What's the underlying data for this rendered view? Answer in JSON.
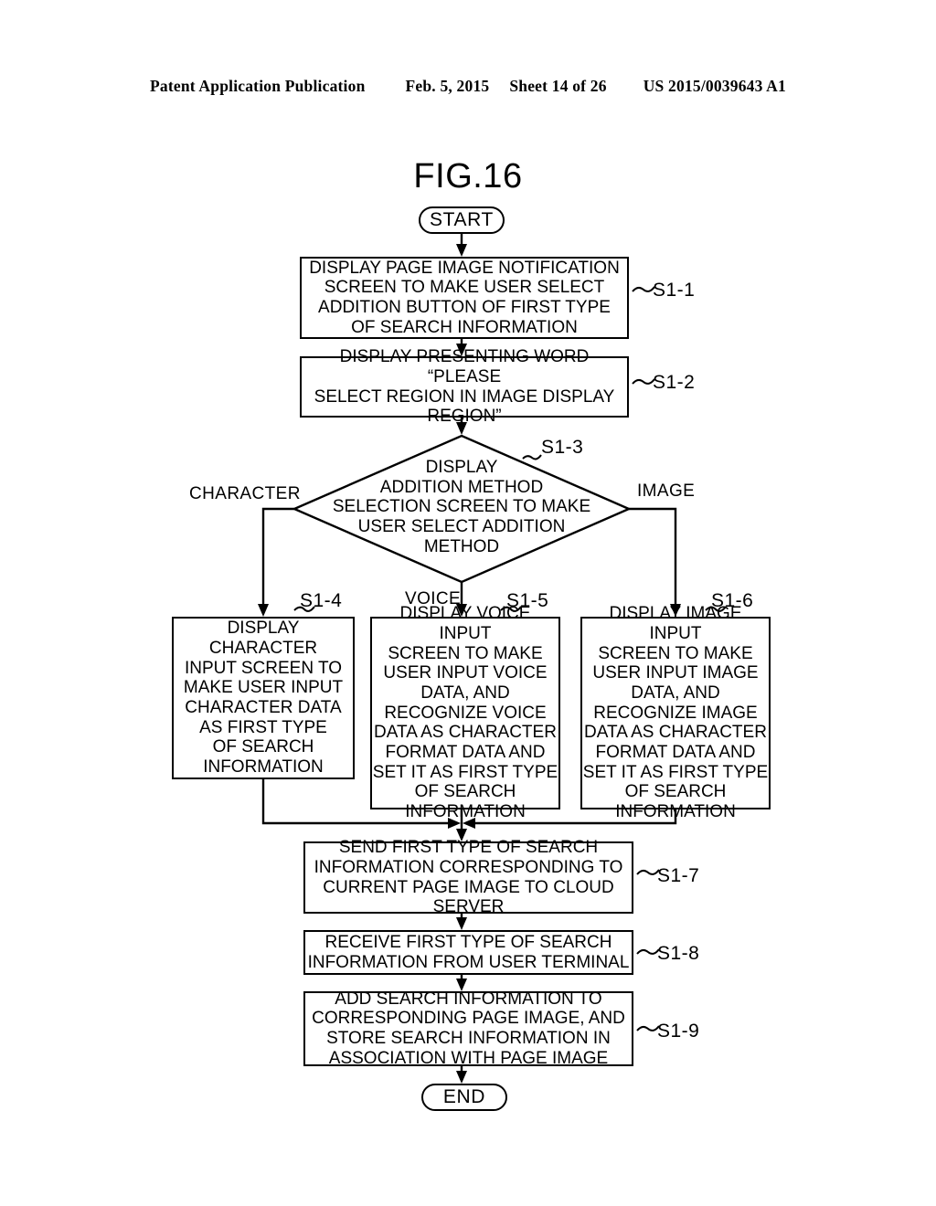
{
  "header": {
    "left": "Patent Application Publication",
    "date": "Feb. 5, 2015",
    "sheet": "Sheet 14 of 26",
    "pub_number": "US 2015/0039643 A1"
  },
  "figure": {
    "title": "FIG.16"
  },
  "flowchart": {
    "start": {
      "label": "START"
    },
    "end": {
      "label": "END"
    },
    "steps": [
      {
        "tag": "S1-1",
        "text": "DISPLAY PAGE IMAGE NOTIFICATION\nSCREEN TO MAKE USER SELECT\nADDITION BUTTON OF FIRST TYPE\nOF SEARCH INFORMATION"
      },
      {
        "tag": "S1-2",
        "text": "DISPLAY PRESENTING WORD “PLEASE\nSELECT REGION IN IMAGE DISPLAY\nREGION”"
      },
      {
        "tag": "S1-3",
        "text": "DISPLAY\nADDITION METHOD\nSELECTION SCREEN TO MAKE\nUSER SELECT ADDITION\nMETHOD"
      },
      {
        "tag": "S1-4",
        "text": "DISPLAY\nCHARACTER\nINPUT SCREEN TO\nMAKE USER INPUT\nCHARACTER DATA\nAS FIRST TYPE\nOF SEARCH\nINFORMATION"
      },
      {
        "tag": "S1-5",
        "text": "DISPLAY VOICE INPUT\nSCREEN TO MAKE\nUSER INPUT VOICE\nDATA, AND\nRECOGNIZE VOICE\nDATA AS CHARACTER\nFORMAT DATA AND\nSET IT AS FIRST TYPE\nOF SEARCH\nINFORMATION"
      },
      {
        "tag": "S1-6",
        "text": "DISPLAY IMAGE INPUT\nSCREEN TO MAKE\nUSER INPUT IMAGE\nDATA, AND\nRECOGNIZE IMAGE\nDATA AS CHARACTER\nFORMAT DATA AND\nSET IT AS FIRST TYPE\nOF SEARCH\nINFORMATION"
      },
      {
        "tag": "S1-7",
        "text": "SEND FIRST TYPE OF SEARCH\nINFORMATION CORRESPONDING TO\nCURRENT PAGE IMAGE TO CLOUD\nSERVER"
      },
      {
        "tag": "S1-8",
        "text": "RECEIVE FIRST TYPE OF SEARCH\nINFORMATION FROM USER TERMINAL"
      },
      {
        "tag": "S1-9",
        "text": "ADD SEARCH INFORMATION TO\nCORRESPONDING PAGE IMAGE, AND\nSTORE SEARCH INFORMATION IN\nASSOCIATION WITH PAGE IMAGE"
      }
    ],
    "branch_labels": {
      "left": "CHARACTER",
      "middle": "VOICE",
      "right": "IMAGE"
    }
  }
}
